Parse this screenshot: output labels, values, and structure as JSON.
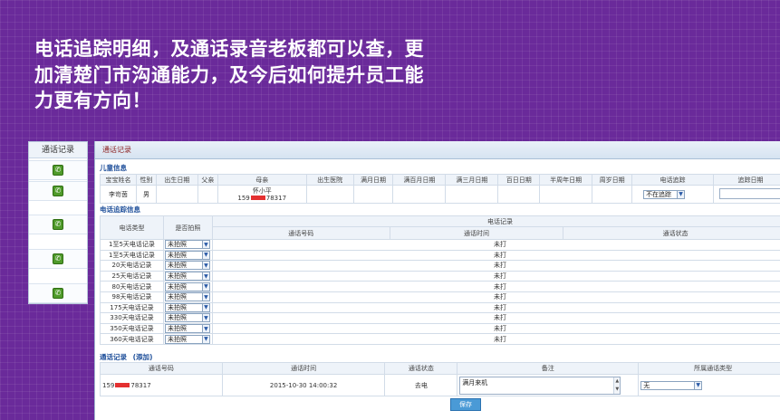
{
  "headline": {
    "line1": "电话追踪明细，及通话录音老板都可以查，更",
    "line2": "加清楚门市沟通能力，及今后如何提升员工能",
    "line3": "力更有方向！"
  },
  "sidebar": {
    "title": "通话记录",
    "items": [
      "phone-icon",
      "phone-icon",
      "phone-icon",
      "phone-icon",
      "phone-icon"
    ]
  },
  "panel": {
    "tab_label": "通话记录"
  },
  "child_info": {
    "title": "儿童信息",
    "headers": [
      "宝宝姓名",
      "性别",
      "出生日期",
      "父亲",
      "母亲",
      "出生医院",
      "满月日期",
      "满百月日期",
      "满三月日期",
      "百日日期",
      "半周年日期",
      "周岁日期",
      "电话追踪",
      "追踪日期"
    ],
    "row": {
      "name": "李岢茵",
      "gender": "男",
      "mother_name": "怀小平",
      "phone_prefix": "159",
      "phone_suffix": "78317",
      "tracking_select": "不在追踪"
    }
  },
  "phone_tracking": {
    "title": "电话追踪信息",
    "headers": {
      "type": "电话类型",
      "handled": "是否拍照",
      "record_group": "电话记录",
      "number": "通话号码",
      "time": "通话时间",
      "status": "通话状态"
    },
    "rows": [
      {
        "type": "1至5天电话记录",
        "handled": "未拍照",
        "status": "未打"
      },
      {
        "type": "1至5天电话记录",
        "handled": "未拍照",
        "status": "未打"
      },
      {
        "type": "20天电话记录",
        "handled": "未拍照",
        "status": "未打"
      },
      {
        "type": "25天电话记录",
        "handled": "未拍照",
        "status": "未打"
      },
      {
        "type": "80天电话记录",
        "handled": "未拍照",
        "status": "未打"
      },
      {
        "type": "98天电话记录",
        "handled": "未拍照",
        "status": "未打"
      },
      {
        "type": "175天电话记录",
        "handled": "未拍照",
        "status": "未打"
      },
      {
        "type": "330天电话记录",
        "handled": "未拍照",
        "status": "未打"
      },
      {
        "type": "350天电话记录",
        "handled": "未拍照",
        "status": "未打"
      },
      {
        "type": "360天电话记录",
        "handled": "未拍照",
        "status": "未打"
      }
    ]
  },
  "call_records": {
    "title": "通话记录",
    "add_link": "(添加)",
    "headers": [
      "通话号码",
      "通话时间",
      "通话状态",
      "备注",
      "所属通话类型"
    ],
    "row": {
      "phone_prefix": "159",
      "phone_suffix": "78317",
      "time": "2015-10-30 14:00:32",
      "status": "去电",
      "note": "满月来机",
      "type_select": "无"
    }
  },
  "save_label": "保存"
}
